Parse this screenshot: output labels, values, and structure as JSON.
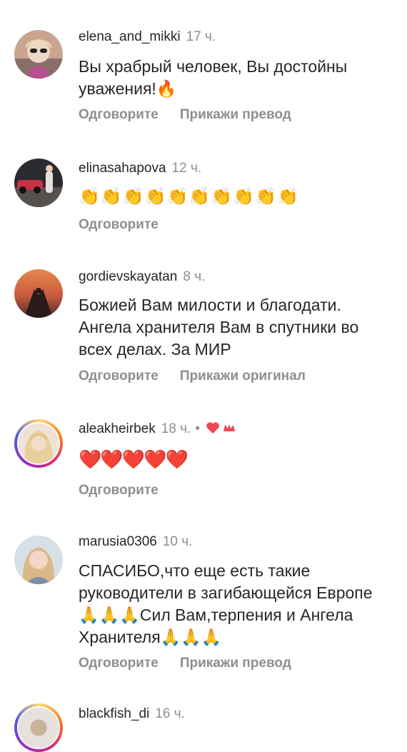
{
  "comments": [
    {
      "username": "elena_and_mikki",
      "time": "17 ч.",
      "text": "Вы храбрый человек, Вы достойны уважения!🔥",
      "reply": "Одговорите",
      "translate": "Прикажи превод"
    },
    {
      "username": "elinasahapova",
      "time": "12 ч.",
      "text": "👏👏👏👏👏👏👏👏👏👏",
      "reply": "Одговорите"
    },
    {
      "username": "gordievskayatan",
      "time": "8 ч.",
      "text": "Божией Вам милости и благодати. Ангела хранителя Вам в спутники во всех делах.  За МИР",
      "reply": "Одговорите",
      "translate": "Прикажи оригинал"
    },
    {
      "username": "aleakheirbek",
      "time": "18 ч.",
      "separator": "•",
      "text": "❤️❤️❤️❤️❤️",
      "reply": "Одговорите"
    },
    {
      "username": "marusia0306",
      "time": "10 ч.",
      "text": "СПАСИБО,что еще есть такие руководители в загибающейся Европе🙏🙏🙏Сил Вам,терпения и Ангела Хранителя🙏🙏🙏",
      "reply": "Одговорите",
      "translate": "Прикажи превод"
    },
    {
      "username": "blackfish_di",
      "time": "16 ч."
    }
  ],
  "colors": {
    "text": "#262626",
    "secondary": "#8e8e8e",
    "liked": "#ed4956"
  },
  "icons": {
    "liked_by_author": "heart-icon",
    "author_badge": "crown-icon"
  }
}
